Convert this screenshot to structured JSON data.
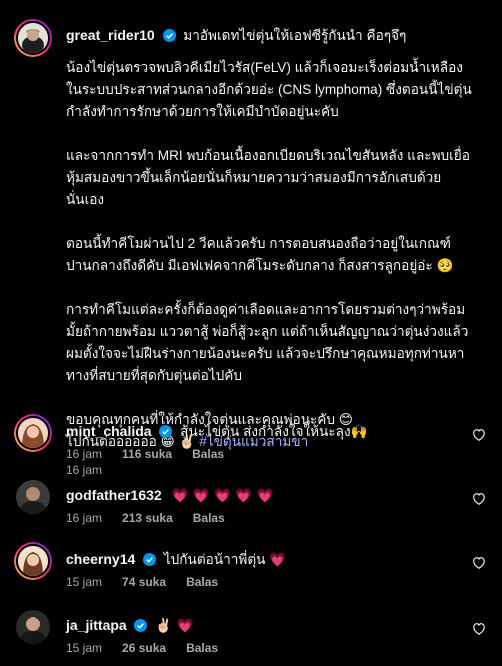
{
  "post": {
    "username": "great_rider10",
    "caption_first": "มาอัพเดทไข่ตุ่นให้เอฟซีรู้กันนำ คือๆจึๆ",
    "paragraphs": [
      "น้องไข่ตุ่นตรวจพบลิวคีเมียไวรัส(FeLV) แล้วก็เจอมะเร็งต่อมน้ำเหลืองในระบบประสาทส่วนกลางอีกด้วยอ่ะ (CNS lymphoma) ซึ่งตอนนี้ไข่ตุ่นกำลังทำการรักษาด้วยการให้เคมีบำบัดอยู่นะคับ",
      "และจากการทำ MRI พบก้อนเนื้องอกเบียดบริเวณไขสันหลัง และพบเยื่อหุ้มสมองขาวขึ้นเล็กน้อยนั่นก็หมายความว่าสมองมีการอักเสบด้วยนั่นเอง",
      "ตอนนี้ทำคีโมผ่านไป 2 วีคแล้วครับ การตอบสนองถือว่าอยู่ในเกณฑ์ปานกลางถึงดีคับ มีเอฟเฟคจากคีโมระดับกลาง ก็สงสารลูกอยู่อ่ะ 🥺",
      "การทำคีโมแต่ละครั้งก็ต้องดูค่าเลือดและอาการโดยรวมต่างๆว่าพร้อมมั้ยถ้ากายพร้อม แววตาสู้ พ่อก็สู้วะลูก แต่ถ้าเห็นสัญญาณว่าตุ่นง่วงแล้ว ผมตั้งใจจะไม่ฝืนร่างกายน้องนะครับ แล้วจะปรึกษาคุณหมอทุกท่านหาทางที่สบายที่สุดกับตุ่นต่อไปคับ"
    ],
    "closing_line1": "ขอบคุณทุกคนที่ให้กำลังใจตุ่นและคุณพ่อนะคับ 😊",
    "closing_line2": "ไปกันต่ออออออ 😁 ✌🏻",
    "hashtag": "#ไข่ตุ่นแมวสามขา",
    "time": "16 jam"
  },
  "comments": [
    {
      "username": "mint_chalida",
      "verified": true,
      "text": "สู้นะไข่ตุ่น ส่งกำลังใจให้นะลุง🙌",
      "time": "16 jam",
      "likes": "116 suka",
      "reply": "Balas"
    },
    {
      "username": "godfather1632",
      "verified": false,
      "text": "💗 💗 💗 💗 💗",
      "time": "16 jam",
      "likes": "213 suka",
      "reply": "Balas"
    },
    {
      "username": "cheerny14",
      "verified": true,
      "text": "ไปกันต่อน้าาพี่ตุ่น 💗",
      "time": "15 jam",
      "likes": "74 suka",
      "reply": "Balas"
    },
    {
      "username": "ja_jittapa",
      "verified": true,
      "text": "✌🏻 💗",
      "time": "15 jam",
      "likes": "26 suka",
      "reply": "Balas"
    }
  ],
  "colors": {
    "background": "#000000",
    "text": "#f5f5f5",
    "muted": "#a8a8a8",
    "verified": "#0095f6",
    "hashtag": "#a0b3ff",
    "heart": "#ff3040"
  },
  "icons": {
    "verified": "verified-badge-icon",
    "like": "heart-outline-icon"
  }
}
